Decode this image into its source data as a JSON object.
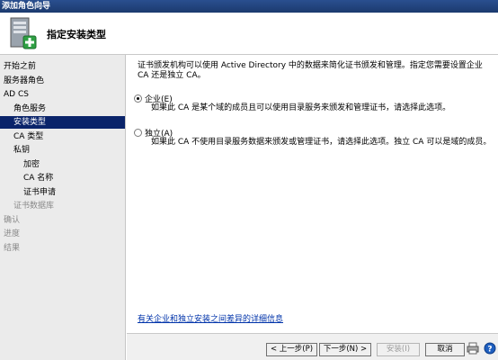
{
  "window": {
    "title": "添加角色向导"
  },
  "header": {
    "title": "指定安装类型"
  },
  "sidebar": {
    "items": [
      {
        "label": "开始之前",
        "level": 0,
        "state": "normal"
      },
      {
        "label": "服务器角色",
        "level": 0,
        "state": "normal"
      },
      {
        "label": "AD CS",
        "level": 0,
        "state": "normal"
      },
      {
        "label": "角色服务",
        "level": 1,
        "state": "normal"
      },
      {
        "label": "安装类型",
        "level": 1,
        "state": "selected"
      },
      {
        "label": "CA 类型",
        "level": 1,
        "state": "normal"
      },
      {
        "label": "私钥",
        "level": 1,
        "state": "normal"
      },
      {
        "label": "加密",
        "level": 2,
        "state": "normal"
      },
      {
        "label": "CA 名称",
        "level": 2,
        "state": "normal"
      },
      {
        "label": "证书申请",
        "level": 2,
        "state": "normal"
      },
      {
        "label": "证书数据库",
        "level": 1,
        "state": "disabled"
      },
      {
        "label": "确认",
        "level": 0,
        "state": "disabled"
      },
      {
        "label": "进度",
        "level": 0,
        "state": "disabled"
      },
      {
        "label": "结果",
        "level": 0,
        "state": "disabled"
      }
    ]
  },
  "content": {
    "intro": "证书颁发机构可以使用 Active Directory 中的数据来简化证书颁发和管理。指定您需要设置企业 CA 还是独立 CA。",
    "options": [
      {
        "label": "企业(E)",
        "checked": true,
        "description": "如果此 CA 是某个域的成员且可以使用目录服务来颁发和管理证书，请选择此选项。"
      },
      {
        "label": "独立(A)",
        "checked": false,
        "description": "如果此 CA 不使用目录服务数据来颁发或管理证书，请选择此选项。独立 CA 可以是域的成员。"
      }
    ],
    "help_link": "有关企业和独立安装之间差异的详细信息"
  },
  "footer": {
    "prev": "< 上一步(P)",
    "next": "下一步(N) >",
    "install": "安装(I)",
    "cancel": "取消"
  }
}
